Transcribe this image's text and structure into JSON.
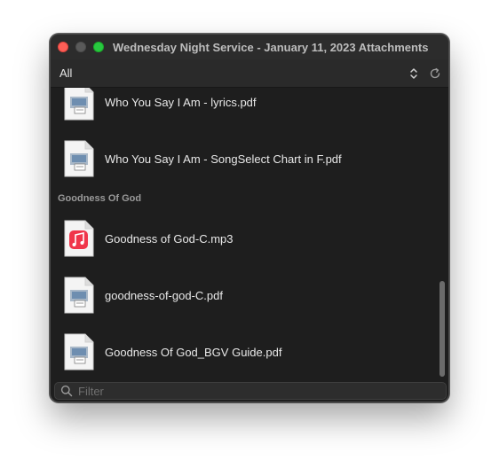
{
  "window": {
    "title": "Wednesday Night Service - January 11, 2023 Attachments"
  },
  "toolbar": {
    "filter_label": "All",
    "sort_icon": "chevron-up-down-icon",
    "refresh_icon": "refresh-icon"
  },
  "list": {
    "items_before_section": [
      {
        "label": "Who You Say I Am - lyrics.pdf",
        "icon": "pdf-file-icon"
      },
      {
        "label": "Who You Say I Am - SongSelect Chart in F.pdf",
        "icon": "pdf-file-icon"
      }
    ],
    "section": {
      "title": "Goodness Of God",
      "items": [
        {
          "label": "Goodness of God-C.mp3",
          "icon": "music-file-icon"
        },
        {
          "label": "goodness-of-god-C.pdf",
          "icon": "pdf-file-icon"
        },
        {
          "label": "Goodness Of God_BGV Guide.pdf",
          "icon": "pdf-file-icon"
        }
      ]
    }
  },
  "search": {
    "placeholder": "Filter",
    "value": ""
  },
  "colors": {
    "close": "#fe5f57",
    "maximize": "#28c840",
    "music_icon": "#f0364b"
  }
}
